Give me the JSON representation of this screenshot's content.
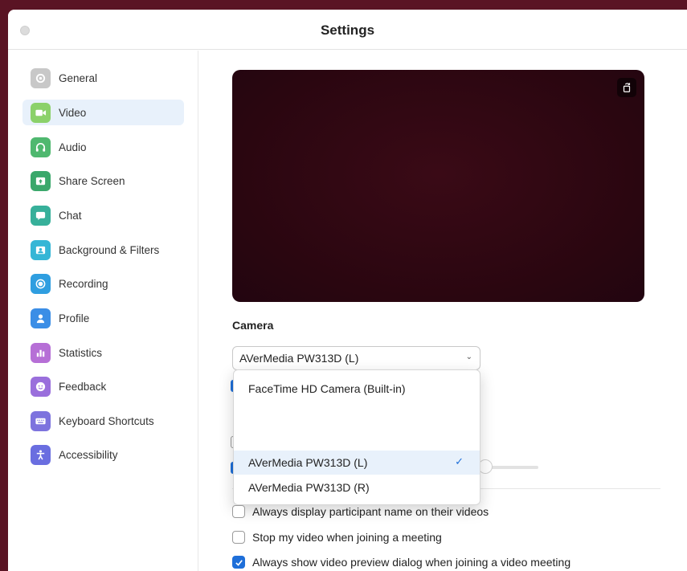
{
  "window": {
    "title": "Settings"
  },
  "sidebar": {
    "items": [
      {
        "label": "General",
        "icon": "gear-icon",
        "color": "#c8c8c8",
        "active": false
      },
      {
        "label": "Video",
        "icon": "video-camera-icon",
        "color": "#8bd16a",
        "active": true
      },
      {
        "label": "Audio",
        "icon": "headphones-icon",
        "color": "#4fb86f",
        "active": false
      },
      {
        "label": "Share Screen",
        "icon": "share-screen-icon",
        "color": "#3aa86b",
        "active": false
      },
      {
        "label": "Chat",
        "icon": "chat-bubble-icon",
        "color": "#37b09a",
        "active": false
      },
      {
        "label": "Background & Filters",
        "icon": "background-icon",
        "color": "#35b6d6",
        "active": false
      },
      {
        "label": "Recording",
        "icon": "record-icon",
        "color": "#2f9ee0",
        "active": false
      },
      {
        "label": "Profile",
        "icon": "person-icon",
        "color": "#3b8ee6",
        "active": false
      },
      {
        "label": "Statistics",
        "icon": "bar-chart-icon",
        "color": "#b66fd6",
        "active": false
      },
      {
        "label": "Feedback",
        "icon": "smile-icon",
        "color": "#9a6fdc",
        "active": false
      },
      {
        "label": "Keyboard Shortcuts",
        "icon": "keyboard-icon",
        "color": "#7d73de",
        "active": false
      },
      {
        "label": "Accessibility",
        "icon": "accessibility-icon",
        "color": "#6a6ee0",
        "active": false
      }
    ]
  },
  "camera": {
    "section_label": "Camera",
    "selected": "AVerMedia PW313D (L)",
    "options": [
      {
        "label": "FaceTime HD Camera (Built-in)",
        "selected": false
      },
      {
        "label": "AVerMedia PW313D (L)",
        "selected": true
      },
      {
        "label": "AVerMedia PW313D (R)",
        "selected": false
      }
    ]
  },
  "checkboxes": [
    {
      "label": "Always display participant name on their videos",
      "checked": false
    },
    {
      "label": "Stop my video when joining a meeting",
      "checked": false
    },
    {
      "label": "Always show video preview dialog when joining a video meeting",
      "checked": true
    }
  ],
  "colors": {
    "accent": "#1e6fd9",
    "selection": "#e8f1fb",
    "preview_bg": "#2c0710"
  }
}
